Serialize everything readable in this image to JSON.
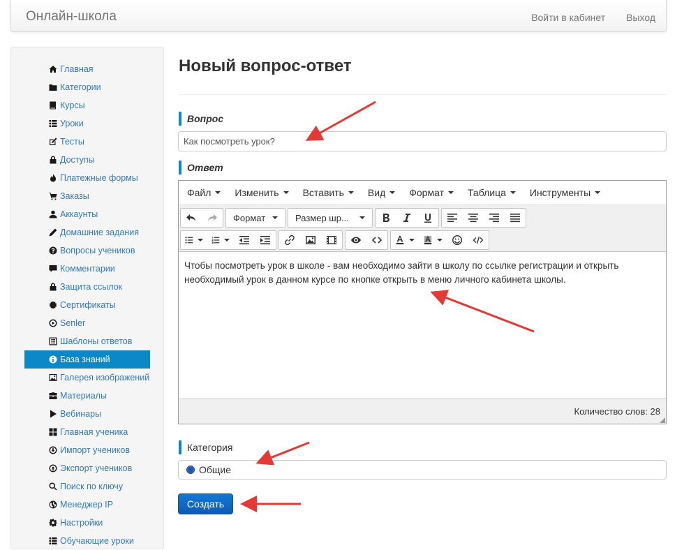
{
  "navbar": {
    "brand": "Онлайн-школа",
    "links": [
      "Войти в кабинет",
      "Выход"
    ]
  },
  "sidebar": {
    "items": [
      {
        "label": "Главная",
        "icon": "home-icon"
      },
      {
        "label": "Категории",
        "icon": "folder-icon"
      },
      {
        "label": "Курсы",
        "icon": "book-icon"
      },
      {
        "label": "Уроки",
        "icon": "list-icon"
      },
      {
        "label": "Тесты",
        "icon": "edit-icon"
      },
      {
        "label": "Доступы",
        "icon": "lock-icon"
      },
      {
        "label": "Платежные формы",
        "icon": "fire-icon"
      },
      {
        "label": "Заказы",
        "icon": "cart-icon"
      },
      {
        "label": "Аккаунты",
        "icon": "user-icon"
      },
      {
        "label": "Домашние задания",
        "icon": "pencil-icon"
      },
      {
        "label": "Вопросы учеников",
        "icon": "question-icon"
      },
      {
        "label": "Комментарии",
        "icon": "comment-icon"
      },
      {
        "label": "Защита ссылок",
        "icon": "lock-icon"
      },
      {
        "label": "Сертификаты",
        "icon": "certificate-icon"
      },
      {
        "label": "Senler",
        "icon": "play-circle-icon"
      },
      {
        "label": "Шаблоны ответов",
        "icon": "list-alt-icon"
      },
      {
        "label": "База знаний",
        "icon": "info-icon",
        "active": true
      },
      {
        "label": "Галерея изображений",
        "icon": "picture-icon"
      },
      {
        "label": "Материалы",
        "icon": "briefcase-icon"
      },
      {
        "label": "Вебинары",
        "icon": "play-icon"
      },
      {
        "label": "Главная ученика",
        "icon": "th-large-icon"
      },
      {
        "label": "Импорт учеников",
        "icon": "import-icon"
      },
      {
        "label": "Экспорт учеников",
        "icon": "export-icon"
      },
      {
        "label": "Поиск по ключу",
        "icon": "search-icon"
      },
      {
        "label": "Менеджер IP",
        "icon": "globe-icon"
      },
      {
        "label": "Настройки",
        "icon": "cog-icon"
      },
      {
        "label": "Обучающие уроки",
        "icon": "list-icon"
      }
    ]
  },
  "page": {
    "title": "Новый вопрос-ответ",
    "question_label": "Вопрос",
    "question_value": "Как посмотреть урок?",
    "answer_label": "Ответ",
    "category_label": "Категория",
    "category_option": "Общие",
    "submit_label": "Создать"
  },
  "editor": {
    "menu": [
      "Файл",
      "Изменить",
      "Вставить",
      "Вид",
      "Формат",
      "Таблица",
      "Инструменты"
    ],
    "format_dropdown": "Формат",
    "fontsize_dropdown": "Размер шр...",
    "content": "Чтобы посмотреть урок в школе - вам необходимо зайти в школу по ссылке регистрации и открыть необходимый урок в данном курсе по кнопке открыть в меню личного кабинета школы.",
    "word_count": "Количество слов: 28"
  },
  "colors": {
    "accent": "#0a88c8",
    "link": "#337ab7",
    "annotation_arrow": "#e53935",
    "button": "#0d5bb5"
  }
}
